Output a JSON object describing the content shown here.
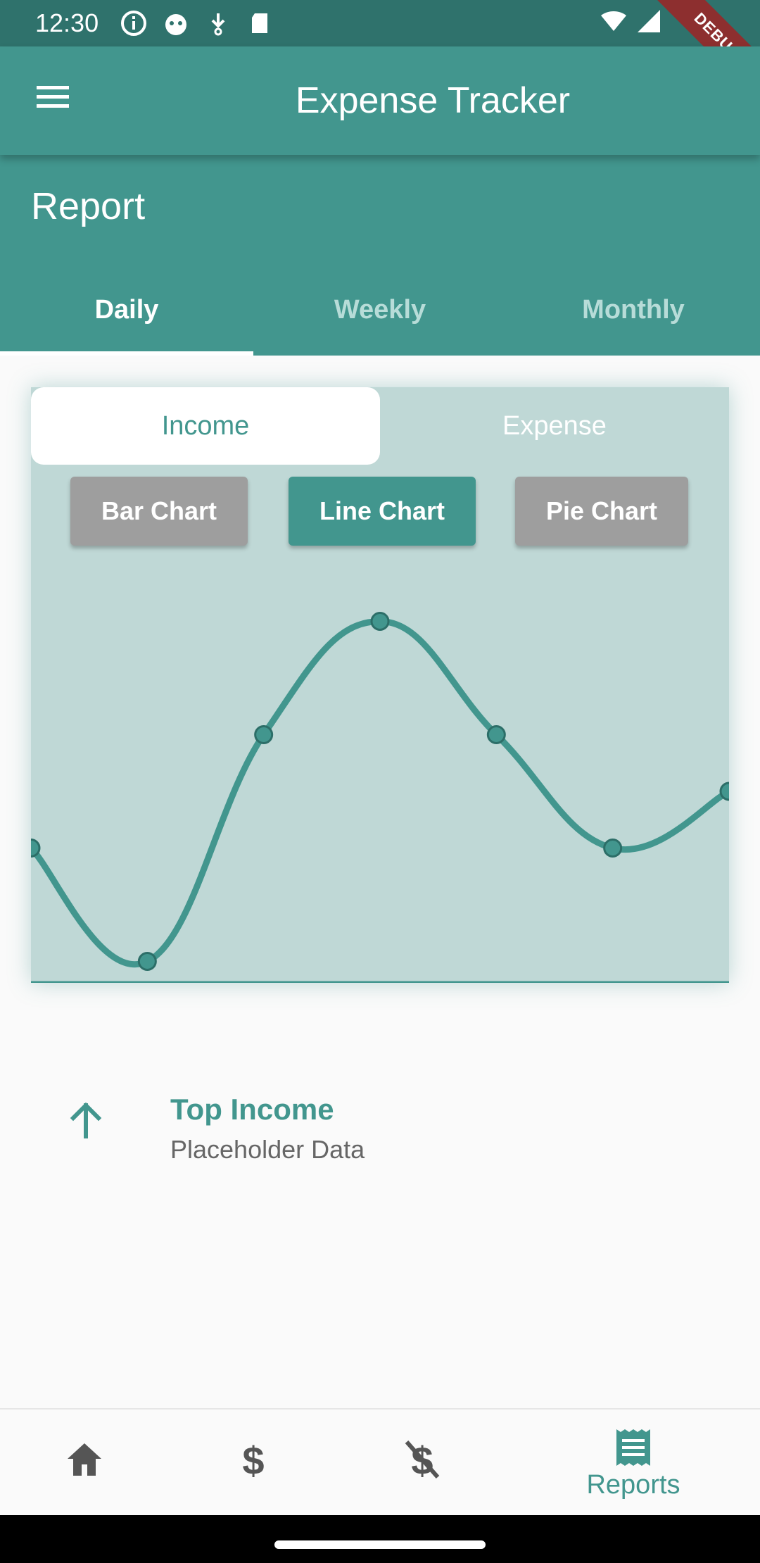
{
  "status": {
    "time": "12:30",
    "debug_label": "DEBUG"
  },
  "app": {
    "title": "Expense Tracker"
  },
  "report": {
    "title": "Report",
    "tabs": [
      {
        "label": "Daily",
        "selected": true
      },
      {
        "label": "Weekly",
        "selected": false
      },
      {
        "label": "Monthly",
        "selected": false
      }
    ]
  },
  "card": {
    "toggle": {
      "income_label": "Income",
      "expense_label": "Expense",
      "selected": "Income"
    },
    "chart_buttons": [
      {
        "label": "Bar Chart",
        "selected": false
      },
      {
        "label": "Line Chart",
        "selected": true
      },
      {
        "label": "Pie Chart",
        "selected": false
      }
    ]
  },
  "chart_data": {
    "type": "line",
    "title": "",
    "xlabel": "",
    "ylabel": "",
    "grid": false,
    "x": [
      0,
      1,
      2,
      3,
      4,
      5,
      6
    ],
    "values": [
      3.0,
      1.0,
      5.0,
      7.0,
      5.0,
      3.0,
      4.0
    ],
    "ylim": [
      0,
      10
    ],
    "color": "#42968e"
  },
  "summary": {
    "title": "Top Income",
    "subtitle": "Placeholder Data"
  },
  "bottom_nav": {
    "items": [
      {
        "icon": "home-icon",
        "label": "",
        "selected": false
      },
      {
        "icon": "dollar-icon",
        "label": "",
        "selected": false
      },
      {
        "icon": "money-off-icon",
        "label": "",
        "selected": false
      },
      {
        "icon": "receipt-icon",
        "label": "Reports",
        "selected": true
      }
    ]
  },
  "colors": {
    "primary": "#42968e",
    "status_bar": "#2f726c",
    "card_bg": "#bfd8d6",
    "inactive_button": "#9e9e9e"
  }
}
